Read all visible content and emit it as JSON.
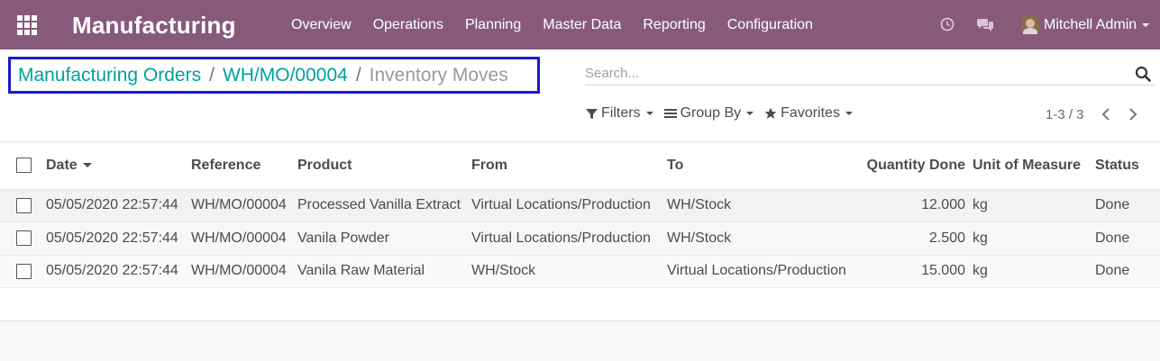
{
  "navbar": {
    "app_title": "Manufacturing",
    "menu": [
      "Overview",
      "Operations",
      "Planning",
      "Master Data",
      "Reporting",
      "Configuration"
    ],
    "user_name": "Mitchell Admin",
    "icons": [
      "apps-grid-icon",
      "clock-icon",
      "chat-icon",
      "user-avatar"
    ],
    "colors": {
      "navbar_bg": "#875a7b",
      "link": "#00a09d",
      "highlight_border": "#1a1ad6"
    }
  },
  "breadcrumb": {
    "items": [
      "Manufacturing Orders",
      "WH/MO/00004"
    ],
    "separator": "/",
    "current": "Inventory Moves"
  },
  "search": {
    "placeholder": "Search...",
    "value": ""
  },
  "filters": {
    "filters_label": "Filters",
    "group_by_label": "Group By",
    "favorites_label": "Favorites"
  },
  "pager": {
    "text": "1-3 / 3",
    "prev": "‹",
    "next": "›"
  },
  "table": {
    "columns": [
      "Date",
      "Reference",
      "Product",
      "From",
      "To",
      "Quantity Done",
      "Unit of Measure",
      "Status"
    ],
    "rows": [
      {
        "date": "05/05/2020 22:57:44",
        "reference": "WH/MO/00004",
        "product": "Processed Vanilla Extract",
        "from": "Virtual Locations/Production",
        "to": "WH/Stock",
        "qty": "12.000",
        "uom": "kg",
        "status": "Done"
      },
      {
        "date": "05/05/2020 22:57:44",
        "reference": "WH/MO/00004",
        "product": "Vanila Powder",
        "from": "Virtual Locations/Production",
        "to": "WH/Stock",
        "qty": "2.500",
        "uom": "kg",
        "status": "Done"
      },
      {
        "date": "05/05/2020 22:57:44",
        "reference": "WH/MO/00004",
        "product": "Vanila Raw Material",
        "from": "WH/Stock",
        "to": "Virtual Locations/Production",
        "qty": "15.000",
        "uom": "kg",
        "status": "Done"
      }
    ]
  }
}
